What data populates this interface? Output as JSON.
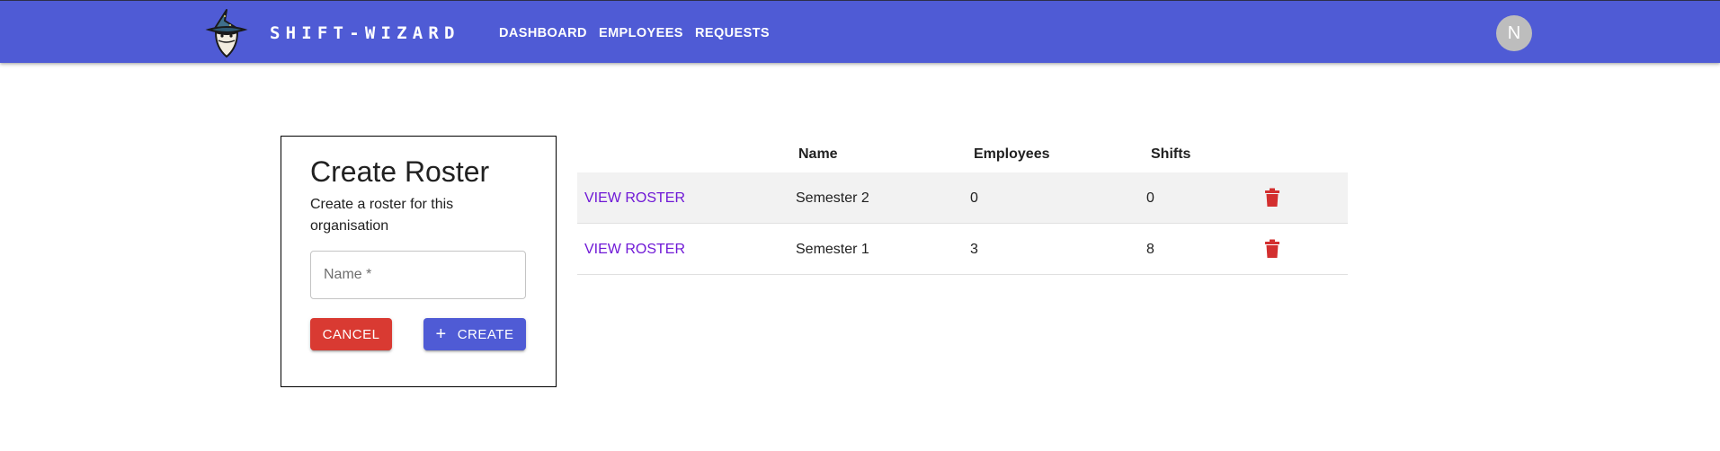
{
  "header": {
    "brand": "SHIFT-WIZARD",
    "nav": [
      "DASHBOARD",
      "EMPLOYEES",
      "REQUESTS"
    ],
    "avatar_initial": "N",
    "color": "#4f5bd5"
  },
  "create_card": {
    "title": "Create Roster",
    "description": "Create a roster for this organisation",
    "name_field": {
      "label": "Name *",
      "value": ""
    },
    "cancel_label": "CANCEL",
    "create_label": "CREATE",
    "cancel_color": "#d93a32"
  },
  "roster_table": {
    "columns": [
      "Name",
      "Employees",
      "Shifts"
    ],
    "view_label": "VIEW ROSTER",
    "rows": [
      {
        "name": "Semester 2",
        "employees": "0",
        "shifts": "0"
      },
      {
        "name": "Semester 1",
        "employees": "3",
        "shifts": "8"
      }
    ],
    "delete_icon": "trash-icon"
  }
}
